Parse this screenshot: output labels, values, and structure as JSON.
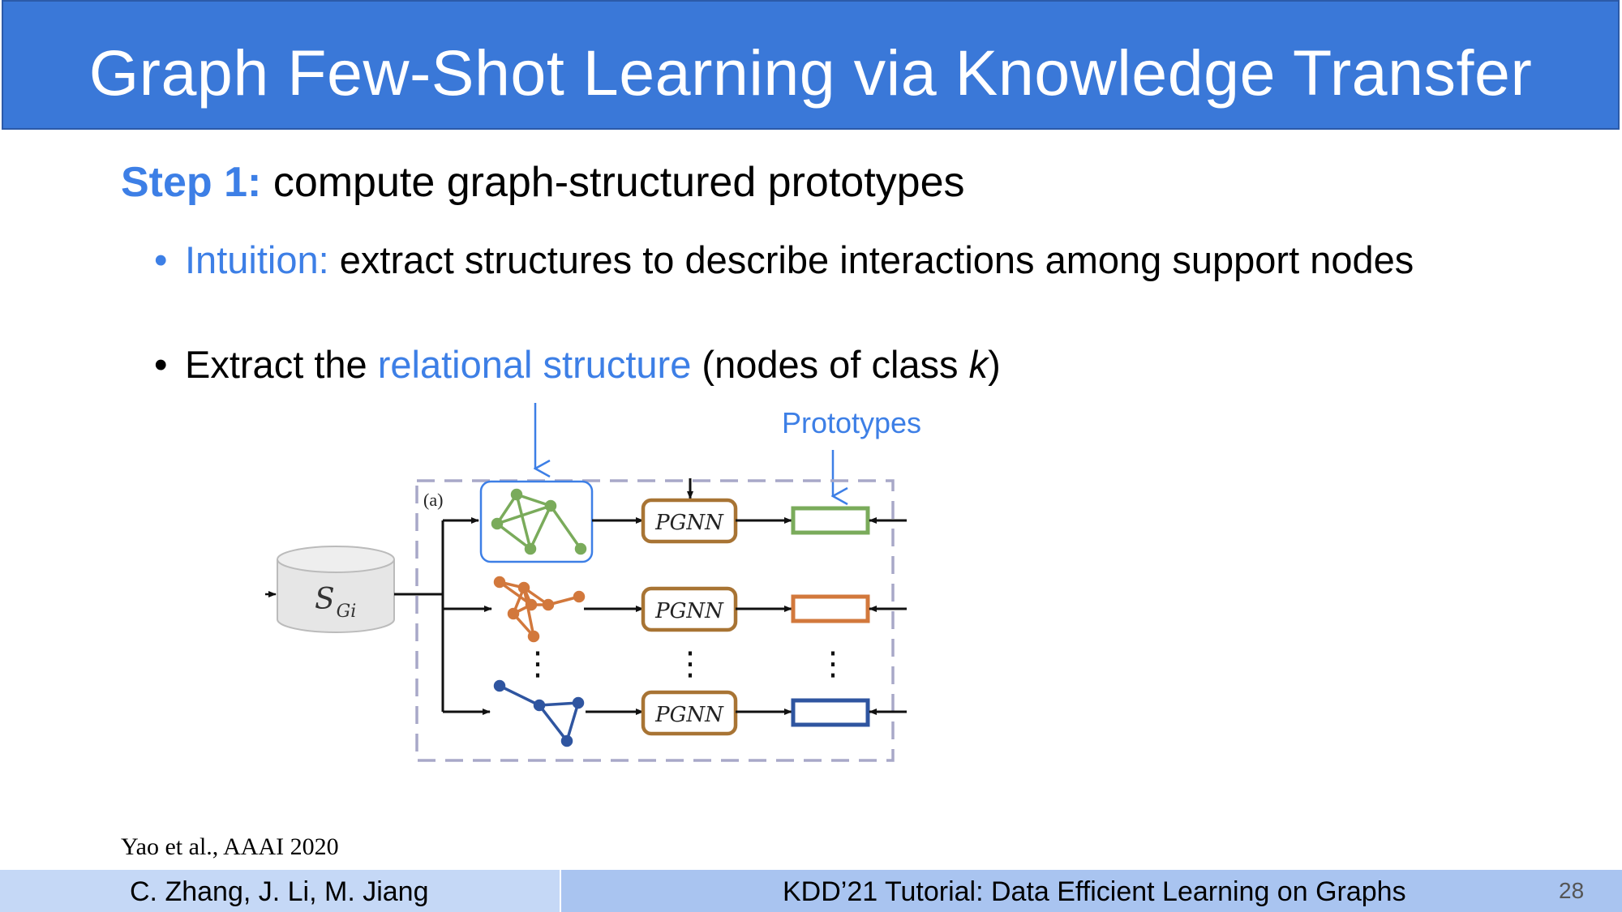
{
  "slide": {
    "title": "Graph Few-Shot Learning via Knowledge Transfer",
    "step_label": "Step 1:",
    "step_text": " compute graph-structured prototypes",
    "bullet1": {
      "dot": "•",
      "label": "Intuition:",
      "text": " extract structures to describe interactions among support nodes"
    },
    "bullet2": {
      "dot": "•",
      "prefix": "Extract the ",
      "highlight": "relational structure",
      "suffix_pre": " (nodes of class ",
      "var": "k",
      "suffix_post": ")"
    }
  },
  "diagram": {
    "prototypes_label": "Prototypes",
    "panel_label": "(a)",
    "database_label": "S",
    "database_sub": "Gi",
    "module_label": "PGNN",
    "ellipsis": "⋮",
    "colors": {
      "green": "#7aab5b",
      "orange": "#d2783c",
      "navy": "#2f55a0",
      "module": "#a87434",
      "dashed": "#a8a8c8",
      "highlight": "#3d7fe6"
    }
  },
  "citation": "Yao et al., AAAI 2020",
  "footer": {
    "authors": "C. Zhang, J. Li, M. Jiang",
    "event": "KDD’21 Tutorial: Data Efficient Learning on Graphs",
    "page": "28"
  }
}
